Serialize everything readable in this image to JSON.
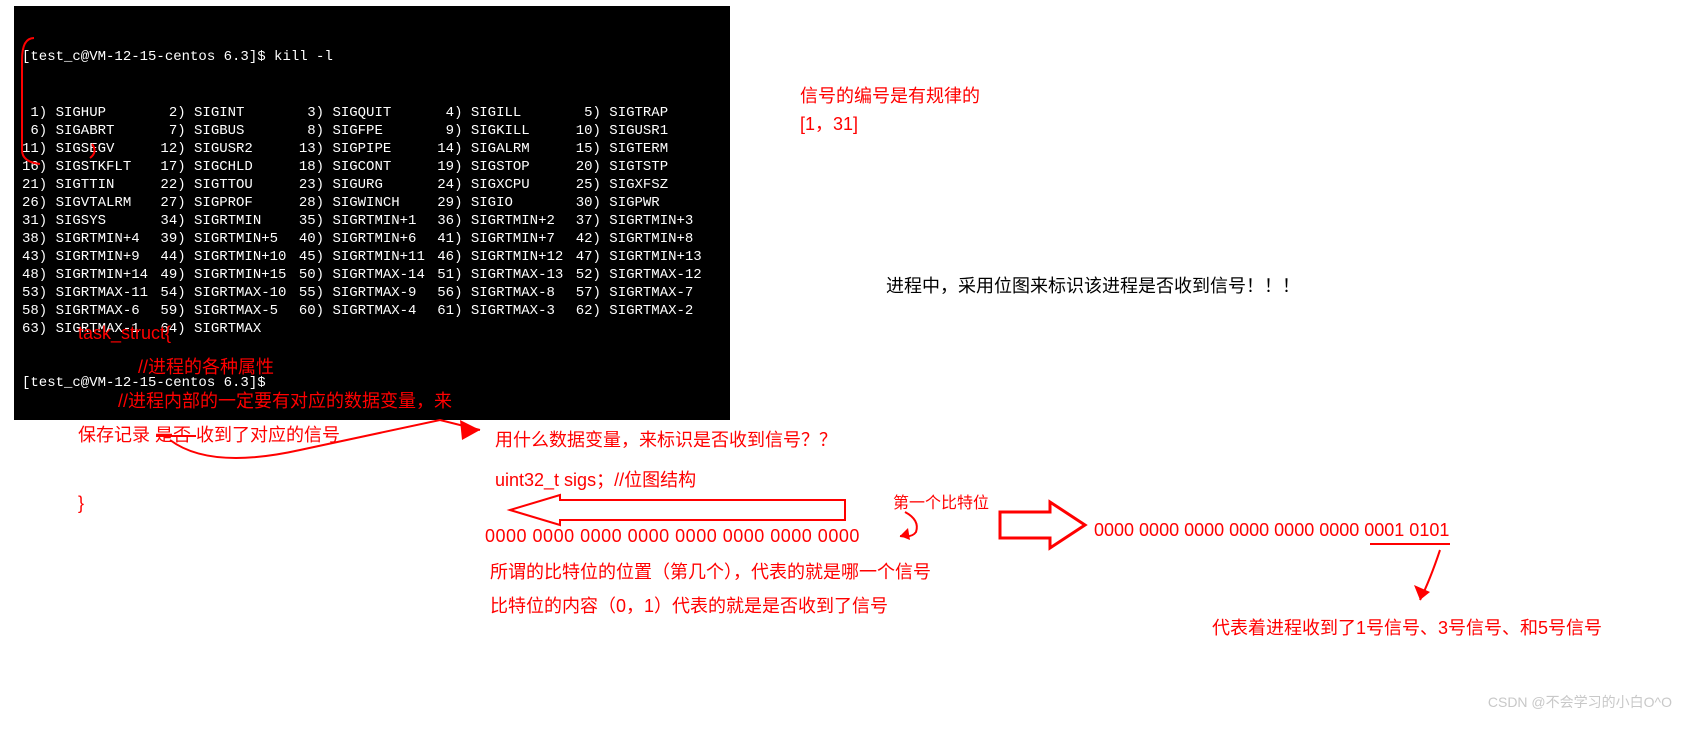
{
  "terminal": {
    "prompt": "[test_c@VM-12-15-centos 6.3]$ kill -l",
    "prompt_end": "[test_c@VM-12-15-centos 6.3]$",
    "signals": [
      {
        "n": "1",
        "name": "SIGHUP"
      },
      {
        "n": "2",
        "name": "SIGINT"
      },
      {
        "n": "3",
        "name": "SIGQUIT"
      },
      {
        "n": "4",
        "name": "SIGILL"
      },
      {
        "n": "5",
        "name": "SIGTRAP"
      },
      {
        "n": "6",
        "name": "SIGABRT"
      },
      {
        "n": "7",
        "name": "SIGBUS"
      },
      {
        "n": "8",
        "name": "SIGFPE"
      },
      {
        "n": "9",
        "name": "SIGKILL"
      },
      {
        "n": "10",
        "name": "SIGUSR1"
      },
      {
        "n": "11",
        "name": "SIGSEGV"
      },
      {
        "n": "12",
        "name": "SIGUSR2"
      },
      {
        "n": "13",
        "name": "SIGPIPE"
      },
      {
        "n": "14",
        "name": "SIGALRM"
      },
      {
        "n": "15",
        "name": "SIGTERM"
      },
      {
        "n": "16",
        "name": "SIGSTKFLT"
      },
      {
        "n": "17",
        "name": "SIGCHLD"
      },
      {
        "n": "18",
        "name": "SIGCONT"
      },
      {
        "n": "19",
        "name": "SIGSTOP"
      },
      {
        "n": "20",
        "name": "SIGTSTP"
      },
      {
        "n": "21",
        "name": "SIGTTIN"
      },
      {
        "n": "22",
        "name": "SIGTTOU"
      },
      {
        "n": "23",
        "name": "SIGURG"
      },
      {
        "n": "24",
        "name": "SIGXCPU"
      },
      {
        "n": "25",
        "name": "SIGXFSZ"
      },
      {
        "n": "26",
        "name": "SIGVTALRM"
      },
      {
        "n": "27",
        "name": "SIGPROF"
      },
      {
        "n": "28",
        "name": "SIGWINCH"
      },
      {
        "n": "29",
        "name": "SIGIO"
      },
      {
        "n": "30",
        "name": "SIGPWR"
      },
      {
        "n": "31",
        "name": "SIGSYS"
      },
      {
        "n": "34",
        "name": "SIGRTMIN"
      },
      {
        "n": "35",
        "name": "SIGRTMIN+1"
      },
      {
        "n": "36",
        "name": "SIGRTMIN+2"
      },
      {
        "n": "37",
        "name": "SIGRTMIN+3"
      },
      {
        "n": "38",
        "name": "SIGRTMIN+4"
      },
      {
        "n": "39",
        "name": "SIGRTMIN+5"
      },
      {
        "n": "40",
        "name": "SIGRTMIN+6"
      },
      {
        "n": "41",
        "name": "SIGRTMIN+7"
      },
      {
        "n": "42",
        "name": "SIGRTMIN+8"
      },
      {
        "n": "43",
        "name": "SIGRTMIN+9"
      },
      {
        "n": "44",
        "name": "SIGRTMIN+10"
      },
      {
        "n": "45",
        "name": "SIGRTMIN+11"
      },
      {
        "n": "46",
        "name": "SIGRTMIN+12"
      },
      {
        "n": "47",
        "name": "SIGRTMIN+13"
      },
      {
        "n": "48",
        "name": "SIGRTMIN+14"
      },
      {
        "n": "49",
        "name": "SIGRTMIN+15"
      },
      {
        "n": "50",
        "name": "SIGRTMAX-14"
      },
      {
        "n": "51",
        "name": "SIGRTMAX-13"
      },
      {
        "n": "52",
        "name": "SIGRTMAX-12"
      },
      {
        "n": "53",
        "name": "SIGRTMAX-11"
      },
      {
        "n": "54",
        "name": "SIGRTMAX-10"
      },
      {
        "n": "55",
        "name": "SIGRTMAX-9"
      },
      {
        "n": "56",
        "name": "SIGRTMAX-8"
      },
      {
        "n": "57",
        "name": "SIGRTMAX-7"
      },
      {
        "n": "58",
        "name": "SIGRTMAX-6"
      },
      {
        "n": "59",
        "name": "SIGRTMAX-5"
      },
      {
        "n": "60",
        "name": "SIGRTMAX-4"
      },
      {
        "n": "61",
        "name": "SIGRTMAX-3"
      },
      {
        "n": "62",
        "name": "SIGRTMAX-2"
      },
      {
        "n": "63",
        "name": "SIGRTMAX-1"
      },
      {
        "n": "64",
        "name": "SIGRTMAX"
      }
    ]
  },
  "right_note": {
    "line1": "信号的编号是有规律的",
    "line2": "[1，31]"
  },
  "bitmap_note": "进程中，采用位图来标识该进程是否收到信号！！！",
  "struct": {
    "open": "task_struct{",
    "c1": "//进程的各种属性",
    "c2": "//进程内部的一定要有对应的数据变量，来",
    "c3": "保存记录 是否 收到了对应的信号",
    "close": "}"
  },
  "q_line": "用什么数据变量，来标识是否收到信号？？",
  "sigs_line": "uint32_t sigs；//位图结构",
  "first_bit_label": "第一个比特位",
  "bits_zero": "0000  0000  0000  0000  0000 0000 0000  0000",
  "bit_meaning1": "所谓的比特位的位置（第几个），代表的就是哪一个信号",
  "bit_meaning2": "比特位的内容（0，1）代表的就是是否收到了信号",
  "bits_result": "0000 0000 0000 0000 0000 0000 0001 0101",
  "result_meaning": "代表着进程收到了1号信号、3号信号、和5号信号",
  "watermark": "CSDN @不会学习的小白O^O"
}
